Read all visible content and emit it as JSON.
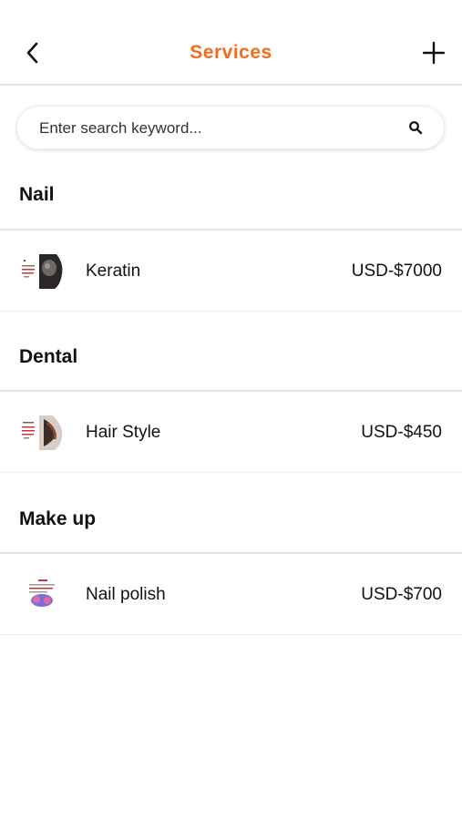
{
  "header": {
    "title": "Services"
  },
  "colors": {
    "accent": "#F26B1F"
  },
  "search": {
    "placeholder": "Enter search keyword..."
  },
  "categories": [
    {
      "name": "Nail",
      "services": [
        {
          "name": "Keratin",
          "price": "USD-$7000",
          "icon": "keratin-thumbnail"
        }
      ]
    },
    {
      "name": "Dental",
      "services": [
        {
          "name": "Hair Style",
          "price": "USD-$450",
          "icon": "hair-style-thumbnail"
        }
      ]
    },
    {
      "name": "Make up",
      "services": [
        {
          "name": "Nail polish",
          "price": "USD-$700",
          "icon": "nail-polish-thumbnail"
        }
      ]
    }
  ]
}
